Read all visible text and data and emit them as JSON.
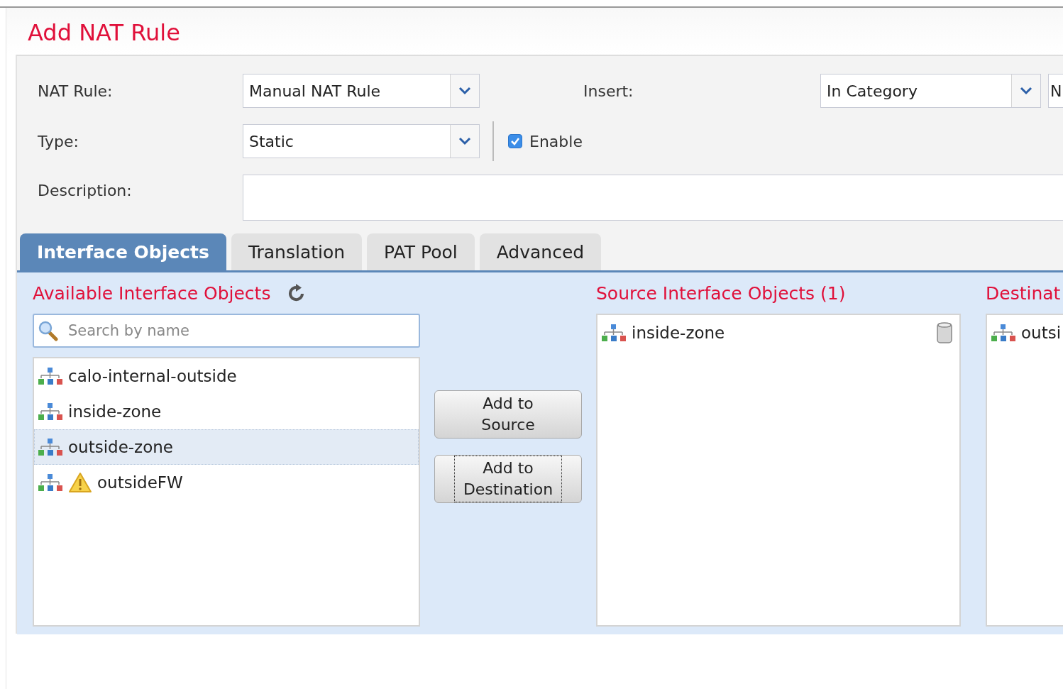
{
  "dialog": {
    "title": "Add NAT Rule"
  },
  "form": {
    "nat_rule": {
      "label": "NAT Rule:",
      "value": "Manual NAT Rule"
    },
    "insert": {
      "label": "Insert:",
      "value": "In Category",
      "value_2": "N"
    },
    "type": {
      "label": "Type:",
      "value": "Static"
    },
    "enable": {
      "label": "Enable",
      "checked": true
    },
    "description": {
      "label": "Description:"
    }
  },
  "tabs": [
    {
      "label": "Interface Objects",
      "selected": true
    },
    {
      "label": "Translation",
      "selected": false
    },
    {
      "label": "PAT Pool",
      "selected": false
    },
    {
      "label": "Advanced",
      "selected": false
    }
  ],
  "available": {
    "title": "Available Interface Objects",
    "search": {
      "placeholder": "Search by name"
    },
    "items": [
      {
        "name": "calo-internal-outside",
        "selected": false,
        "warning": false
      },
      {
        "name": "inside-zone",
        "selected": false,
        "warning": false
      },
      {
        "name": "outside-zone",
        "selected": true,
        "warning": false
      },
      {
        "name": "outsideFW",
        "selected": false,
        "warning": true
      }
    ]
  },
  "buttons": [
    {
      "label": "Add to Source",
      "focused": false
    },
    {
      "label": "Add to Destination",
      "focused": true
    }
  ],
  "source": {
    "title": "Source Interface Objects (1)",
    "items": [
      {
        "name": "inside-zone"
      }
    ]
  },
  "destination": {
    "title": "Destinat",
    "items": [
      {
        "name": "outsi"
      }
    ]
  }
}
